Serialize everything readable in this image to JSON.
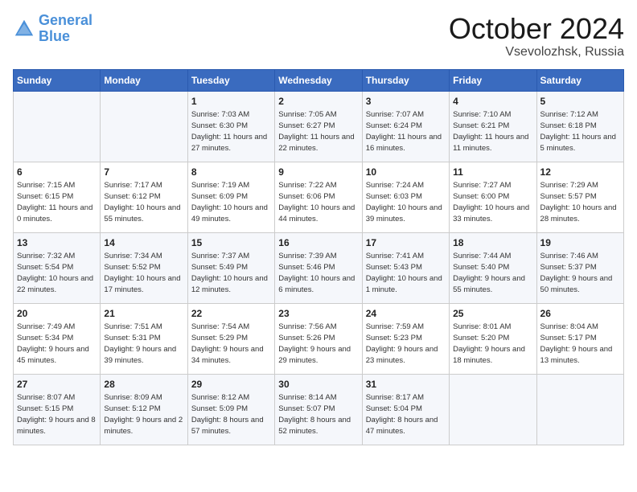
{
  "header": {
    "logo_line1": "General",
    "logo_line2": "Blue",
    "month": "October 2024",
    "location": "Vsevolozhsk, Russia"
  },
  "weekdays": [
    "Sunday",
    "Monday",
    "Tuesday",
    "Wednesday",
    "Thursday",
    "Friday",
    "Saturday"
  ],
  "weeks": [
    [
      {
        "day": "",
        "info": ""
      },
      {
        "day": "",
        "info": ""
      },
      {
        "day": "1",
        "info": "Sunrise: 7:03 AM\nSunset: 6:30 PM\nDaylight: 11 hours and 27 minutes."
      },
      {
        "day": "2",
        "info": "Sunrise: 7:05 AM\nSunset: 6:27 PM\nDaylight: 11 hours and 22 minutes."
      },
      {
        "day": "3",
        "info": "Sunrise: 7:07 AM\nSunset: 6:24 PM\nDaylight: 11 hours and 16 minutes."
      },
      {
        "day": "4",
        "info": "Sunrise: 7:10 AM\nSunset: 6:21 PM\nDaylight: 11 hours and 11 minutes."
      },
      {
        "day": "5",
        "info": "Sunrise: 7:12 AM\nSunset: 6:18 PM\nDaylight: 11 hours and 5 minutes."
      }
    ],
    [
      {
        "day": "6",
        "info": "Sunrise: 7:15 AM\nSunset: 6:15 PM\nDaylight: 11 hours and 0 minutes."
      },
      {
        "day": "7",
        "info": "Sunrise: 7:17 AM\nSunset: 6:12 PM\nDaylight: 10 hours and 55 minutes."
      },
      {
        "day": "8",
        "info": "Sunrise: 7:19 AM\nSunset: 6:09 PM\nDaylight: 10 hours and 49 minutes."
      },
      {
        "day": "9",
        "info": "Sunrise: 7:22 AM\nSunset: 6:06 PM\nDaylight: 10 hours and 44 minutes."
      },
      {
        "day": "10",
        "info": "Sunrise: 7:24 AM\nSunset: 6:03 PM\nDaylight: 10 hours and 39 minutes."
      },
      {
        "day": "11",
        "info": "Sunrise: 7:27 AM\nSunset: 6:00 PM\nDaylight: 10 hours and 33 minutes."
      },
      {
        "day": "12",
        "info": "Sunrise: 7:29 AM\nSunset: 5:57 PM\nDaylight: 10 hours and 28 minutes."
      }
    ],
    [
      {
        "day": "13",
        "info": "Sunrise: 7:32 AM\nSunset: 5:54 PM\nDaylight: 10 hours and 22 minutes."
      },
      {
        "day": "14",
        "info": "Sunrise: 7:34 AM\nSunset: 5:52 PM\nDaylight: 10 hours and 17 minutes."
      },
      {
        "day": "15",
        "info": "Sunrise: 7:37 AM\nSunset: 5:49 PM\nDaylight: 10 hours and 12 minutes."
      },
      {
        "day": "16",
        "info": "Sunrise: 7:39 AM\nSunset: 5:46 PM\nDaylight: 10 hours and 6 minutes."
      },
      {
        "day": "17",
        "info": "Sunrise: 7:41 AM\nSunset: 5:43 PM\nDaylight: 10 hours and 1 minute."
      },
      {
        "day": "18",
        "info": "Sunrise: 7:44 AM\nSunset: 5:40 PM\nDaylight: 9 hours and 55 minutes."
      },
      {
        "day": "19",
        "info": "Sunrise: 7:46 AM\nSunset: 5:37 PM\nDaylight: 9 hours and 50 minutes."
      }
    ],
    [
      {
        "day": "20",
        "info": "Sunrise: 7:49 AM\nSunset: 5:34 PM\nDaylight: 9 hours and 45 minutes."
      },
      {
        "day": "21",
        "info": "Sunrise: 7:51 AM\nSunset: 5:31 PM\nDaylight: 9 hours and 39 minutes."
      },
      {
        "day": "22",
        "info": "Sunrise: 7:54 AM\nSunset: 5:29 PM\nDaylight: 9 hours and 34 minutes."
      },
      {
        "day": "23",
        "info": "Sunrise: 7:56 AM\nSunset: 5:26 PM\nDaylight: 9 hours and 29 minutes."
      },
      {
        "day": "24",
        "info": "Sunrise: 7:59 AM\nSunset: 5:23 PM\nDaylight: 9 hours and 23 minutes."
      },
      {
        "day": "25",
        "info": "Sunrise: 8:01 AM\nSunset: 5:20 PM\nDaylight: 9 hours and 18 minutes."
      },
      {
        "day": "26",
        "info": "Sunrise: 8:04 AM\nSunset: 5:17 PM\nDaylight: 9 hours and 13 minutes."
      }
    ],
    [
      {
        "day": "27",
        "info": "Sunrise: 8:07 AM\nSunset: 5:15 PM\nDaylight: 9 hours and 8 minutes."
      },
      {
        "day": "28",
        "info": "Sunrise: 8:09 AM\nSunset: 5:12 PM\nDaylight: 9 hours and 2 minutes."
      },
      {
        "day": "29",
        "info": "Sunrise: 8:12 AM\nSunset: 5:09 PM\nDaylight: 8 hours and 57 minutes."
      },
      {
        "day": "30",
        "info": "Sunrise: 8:14 AM\nSunset: 5:07 PM\nDaylight: 8 hours and 52 minutes."
      },
      {
        "day": "31",
        "info": "Sunrise: 8:17 AM\nSunset: 5:04 PM\nDaylight: 8 hours and 47 minutes."
      },
      {
        "day": "",
        "info": ""
      },
      {
        "day": "",
        "info": ""
      }
    ]
  ]
}
